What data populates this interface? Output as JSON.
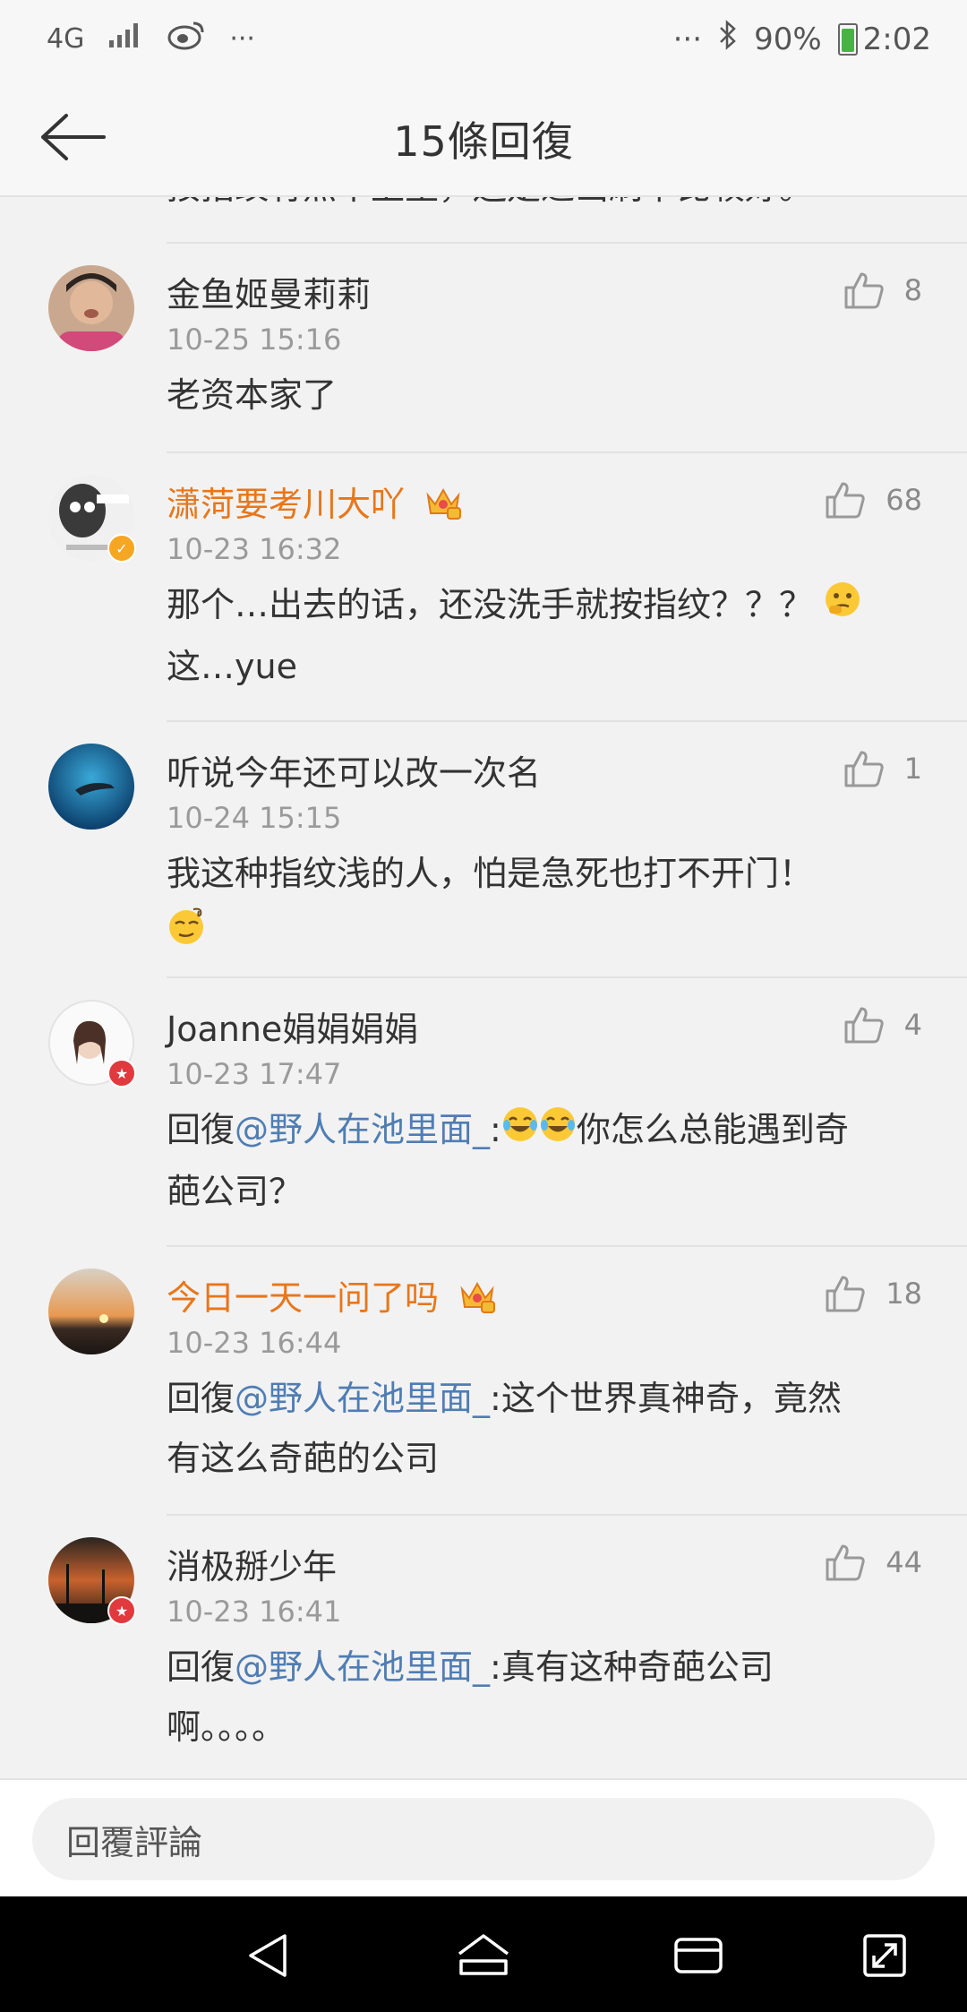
{
  "status_bar": {
    "network": "4G",
    "dots_left": "···",
    "dots_right": "···",
    "battery": "90%",
    "time": "2:02"
  },
  "app_bar": {
    "title": "15條回復"
  },
  "partial_top_text": "按指纹有点不卫生，还是进出刷卡比较好。",
  "comments": [
    {
      "name": "金鱼姬曼莉莉",
      "time": "10-25 15:16",
      "likes": "8",
      "text": "老资本家了"
    },
    {
      "name": "潇菏要考川大吖",
      "time": "10-23 16:32",
      "likes": "68",
      "text_a": "那个…出去的话，还没洗手就按指纹？？？",
      "text_b": "这…yue"
    },
    {
      "name": "听说今年还可以改一次名",
      "time": "10-24 15:15",
      "likes": "1",
      "text_a": "我这种指纹浅的人，怕是急死也打不开门！"
    },
    {
      "name": "Joanne娟娟娟娟",
      "time": "10-23 17:47",
      "likes": "4",
      "reply_prefix": "回復",
      "mention": "@野人在池里面_",
      "text_a": ":",
      "text_b": "你怎么总能遇到奇",
      "text_c": "葩公司？"
    },
    {
      "name": "今日一天一问了吗",
      "time": "10-23 16:44",
      "likes": "18",
      "reply_prefix": "回復",
      "mention": "@野人在池里面_",
      "text_a": ":这个世界真神奇，竟然",
      "text_b": "有这么奇葩的公司"
    },
    {
      "name": "消极掰少年",
      "time": "10-23 16:41",
      "likes": "44",
      "reply_prefix": "回復",
      "mention": "@野人在池里面_",
      "text_a": ":真有这种奇葩公司",
      "text_b": "啊。。。。"
    }
  ],
  "reply_bar": {
    "placeholder": "回覆評論"
  },
  "colors": {
    "vip_name": "#e8761a",
    "mention": "#4f7db3",
    "timestamp": "#9a9a9a"
  }
}
